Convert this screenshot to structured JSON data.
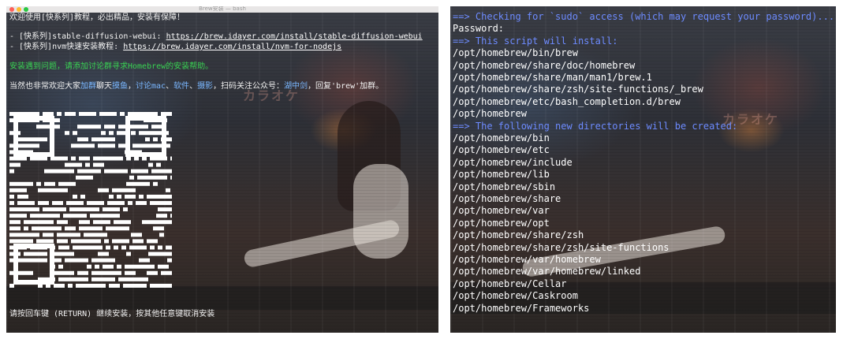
{
  "left_terminal": {
    "window_title": "Brew安装 — bash",
    "lines": {
      "welcome": "欢迎使用[快系列]教程，必出精品，安装有保障！",
      "item1_prefix": "- [快系列]stable-diffusion-webui: ",
      "item1_link": "https://brew.idayer.com/install/stable-diffusion-webui",
      "item2_prefix": "- [快系列]nvm快速安装教程: ",
      "item2_link": "https://brew.idayer.com/install/nvm-for-nodejs",
      "help": "安装遇到问题，请添加讨论群寻求Homebrew的安装帮助。",
      "invite_prefix": "当然也非常欢迎大家",
      "invite_join": "加群",
      "invite_chat": "聊天",
      "invite_fish": "摸鱼",
      "invite_sep1": "，",
      "invite_topic1": "讨论mac",
      "invite_sep2": "、",
      "invite_topic2": "软件",
      "invite_sep3": "、",
      "invite_topic3": "摄影",
      "invite_mid": "，扫码关注公众号：",
      "invite_account": "湖中剑",
      "invite_suffix": "，回复'brew'加群。",
      "prompt": "请按回车键 (RETURN) 继续安装，按其他任意键取消安装"
    }
  },
  "right_terminal": {
    "lines": [
      {
        "text": "==> Checking for `sudo` access (which may request your password)...",
        "color": "blue"
      },
      {
        "text": "Password:",
        "color": "white"
      },
      {
        "text": "==> This script will install:",
        "color": "blue"
      },
      {
        "text": "/opt/homebrew/bin/brew",
        "color": "white"
      },
      {
        "text": "/opt/homebrew/share/doc/homebrew",
        "color": "white"
      },
      {
        "text": "/opt/homebrew/share/man/man1/brew.1",
        "color": "white"
      },
      {
        "text": "/opt/homebrew/share/zsh/site-functions/_brew",
        "color": "white"
      },
      {
        "text": "/opt/homebrew/etc/bash_completion.d/brew",
        "color": "white"
      },
      {
        "text": "/opt/homebrew",
        "color": "white"
      },
      {
        "text": "==> The following new directories will be created:",
        "color": "blue"
      },
      {
        "text": "/opt/homebrew/bin",
        "color": "white"
      },
      {
        "text": "/opt/homebrew/etc",
        "color": "white"
      },
      {
        "text": "/opt/homebrew/include",
        "color": "white"
      },
      {
        "text": "/opt/homebrew/lib",
        "color": "white"
      },
      {
        "text": "/opt/homebrew/sbin",
        "color": "white"
      },
      {
        "text": "/opt/homebrew/share",
        "color": "white"
      },
      {
        "text": "/opt/homebrew/var",
        "color": "white"
      },
      {
        "text": "/opt/homebrew/opt",
        "color": "white"
      },
      {
        "text": "/opt/homebrew/share/zsh",
        "color": "white"
      },
      {
        "text": "/opt/homebrew/share/zsh/site-functions",
        "color": "white"
      },
      {
        "text": "/opt/homebrew/var/homebrew",
        "color": "white"
      },
      {
        "text": "/opt/homebrew/var/homebrew/linked",
        "color": "white"
      },
      {
        "text": "/opt/homebrew/Cellar",
        "color": "white"
      },
      {
        "text": "/opt/homebrew/Caskroom",
        "color": "white"
      },
      {
        "text": "/opt/homebrew/Frameworks",
        "color": "white"
      }
    ]
  },
  "colors": {
    "prompt_blue": "#6d8bff",
    "success_green": "#39d353",
    "terminal_text": "#ffffff",
    "traffic_red": "#fe5f57",
    "traffic_yellow": "#febc2e",
    "traffic_green": "#28c840"
  },
  "icons": {
    "qr": "qr-code-icon",
    "close": "close-icon",
    "minimize": "minimize-icon",
    "zoom": "zoom-icon"
  }
}
